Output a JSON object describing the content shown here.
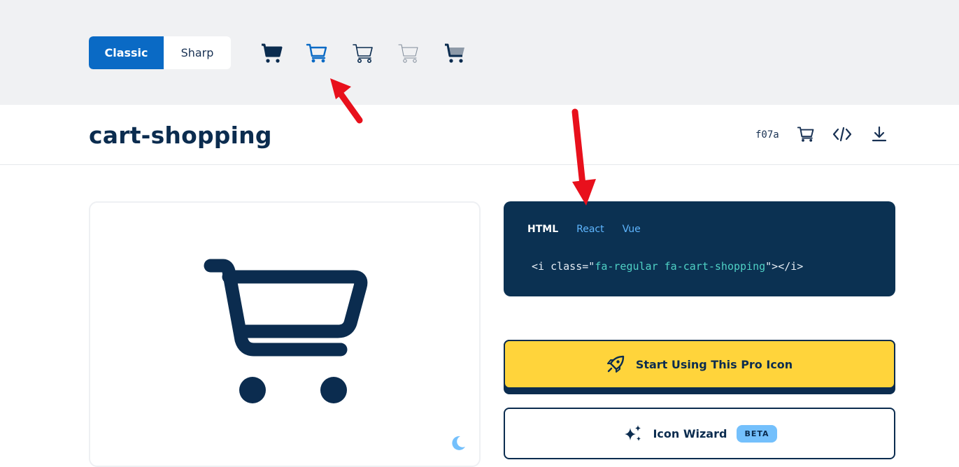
{
  "style_toggle": {
    "classic_label": "Classic",
    "sharp_label": "Sharp",
    "selected": "Classic"
  },
  "variants": [
    {
      "icon": "cart-shopping-solid-icon",
      "style": "solid"
    },
    {
      "icon": "cart-shopping-regular-icon",
      "style": "regular",
      "selected": true
    },
    {
      "icon": "cart-shopping-light-icon",
      "style": "light"
    },
    {
      "icon": "cart-shopping-thin-icon",
      "style": "thin"
    },
    {
      "icon": "cart-shopping-duotone-icon",
      "style": "duotone"
    }
  ],
  "header": {
    "title": "cart-shopping",
    "unicode": "f07a",
    "actions": [
      "cart-icon",
      "code-icon",
      "download-icon"
    ]
  },
  "preview": {
    "icon": "cart-shopping-regular-icon",
    "toggle": "moon-icon"
  },
  "code_panel": {
    "tabs": [
      "HTML",
      "React",
      "Vue"
    ],
    "active_tab": "HTML",
    "code_prefix": "<i class=\"",
    "code_value": "fa-regular fa-cart-shopping",
    "code_suffix": "\"></i>"
  },
  "buttons": {
    "start_label": "Start Using This Pro Icon",
    "wizard_label": "Icon Wizard",
    "wizard_badge": "BETA"
  },
  "colors": {
    "accent_blue": "#0a6ac5",
    "navy": "#0b2c4f",
    "code_bg": "#0b3152",
    "yellow": "#ffd43b",
    "annotation_red": "#e8101c"
  }
}
